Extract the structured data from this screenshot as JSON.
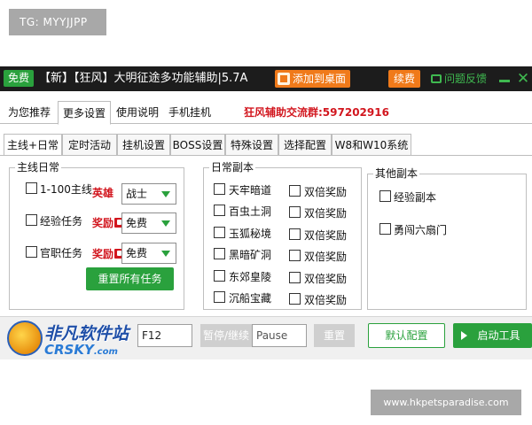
{
  "watermark_top": "TG: MYYJJPP",
  "titlebar": {
    "free_badge": "免费",
    "title": "【新】【狂风】大明征途多功能辅助|5.7A",
    "add_desktop": "添加到桌面",
    "renew": "续费",
    "feedback": "问题反馈"
  },
  "main_tabs": [
    "为您推荐",
    "更多设置",
    "使用说明",
    "手机挂机"
  ],
  "group_info": "狂风辅助交流群:597202916",
  "sub_tabs": [
    "主线+日常",
    "定时活动",
    "挂机设置",
    "BOSS设置",
    "特殊设置",
    "选择配置",
    "W8和W10系统"
  ],
  "main_daily": {
    "title": "主线日常",
    "rows": [
      {
        "label": "1-100主线",
        "tag": "英雄",
        "value": "战士"
      },
      {
        "label": "经验任务",
        "tag": "奖励",
        "value": "免费"
      },
      {
        "label": "官职任务",
        "tag": "奖励",
        "value": "免费"
      }
    ],
    "reset_button": "重置所有任务"
  },
  "daily_dungeon": {
    "title": "日常副本",
    "left": [
      "天牢暗道",
      "百虫土洞",
      "玉狐秘境",
      "黑暗矿洞",
      "东郊皇陵",
      "沉船宝藏"
    ],
    "right": [
      "双倍奖励",
      "双倍奖励",
      "双倍奖励",
      "双倍奖励",
      "双倍奖励",
      "双倍奖励"
    ]
  },
  "other_dungeon": {
    "title": "其他副本",
    "items": [
      "经验副本",
      "勇闯六扇门"
    ]
  },
  "bottom": {
    "hotkey_value": "F12",
    "pause_label": "暂停/继续",
    "pause_value": "Pause",
    "reset_label": "重置",
    "default_config": "默认配置",
    "start_tool": "启动工具"
  },
  "logo": {
    "cn": "非凡软件站",
    "en": "CRSKY",
    "com": ".com"
  },
  "watermark_bottom": "www.hkpetsparadise.com"
}
